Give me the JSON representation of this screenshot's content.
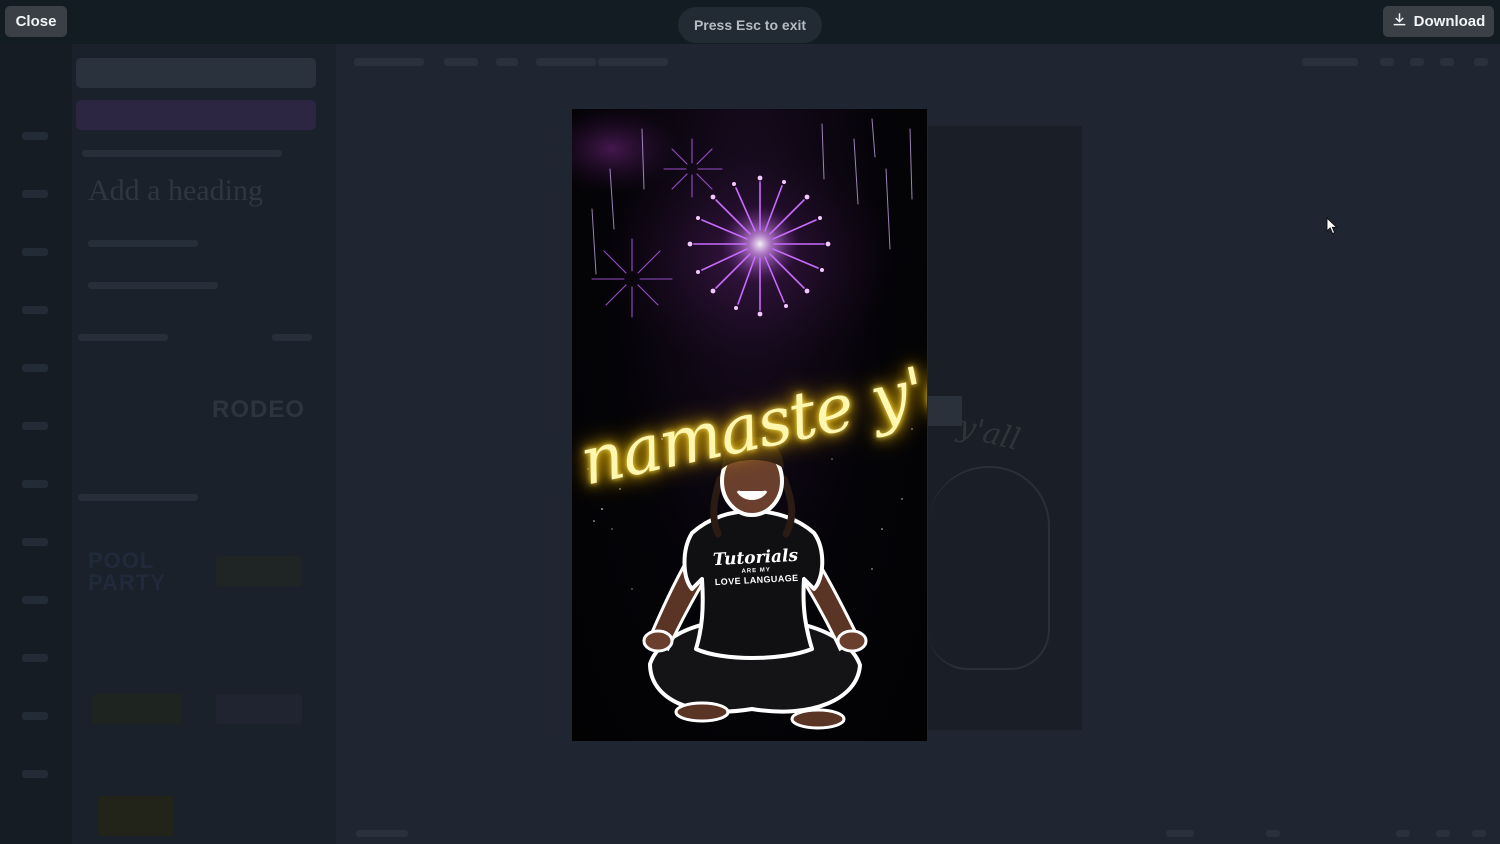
{
  "controls": {
    "close_label": "Close",
    "exit_hint": "Press Esc to exit",
    "download_label": "Download"
  },
  "slide": {
    "neon_text": "namaste y'all",
    "shirt_script": "Tutorials",
    "shirt_small": "ARE MY",
    "shirt_main": "LOVE LANGUAGE"
  },
  "background_editor": {
    "heading_preview": "Add a heading",
    "template_tiles": [
      "RODEO",
      "POOL PARTY"
    ]
  },
  "colors": {
    "neon": "#ffe14d",
    "firework": "#c86bff",
    "overlay_button": "#3a4046"
  }
}
